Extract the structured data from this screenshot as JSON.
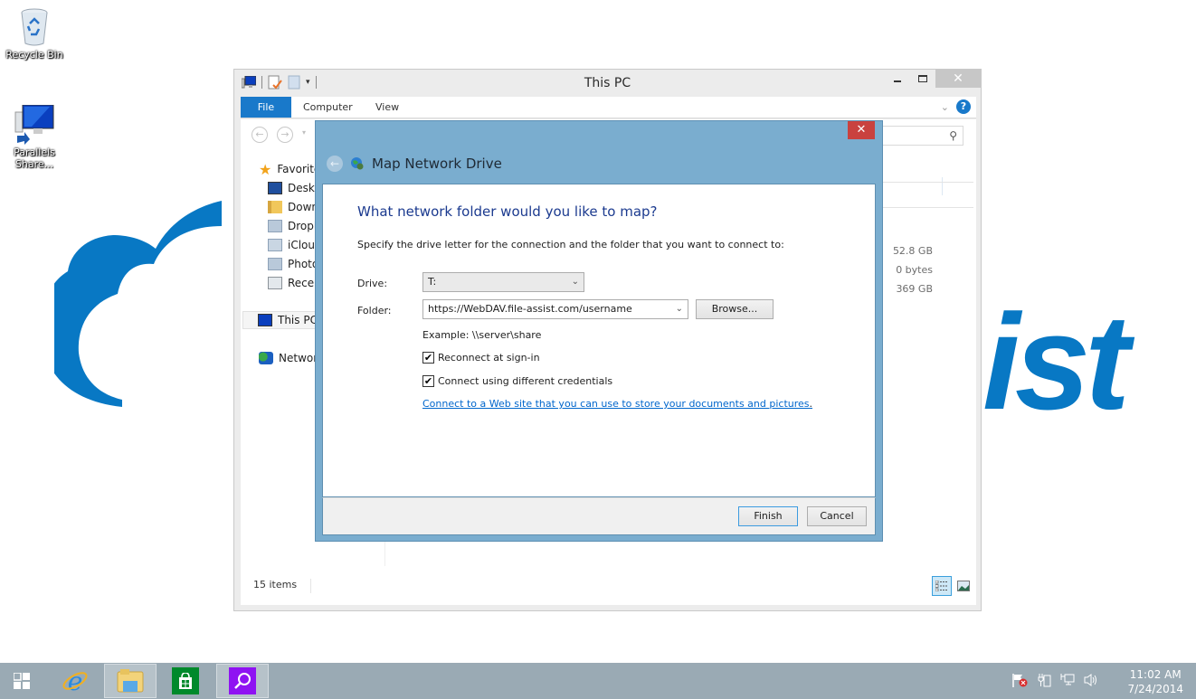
{
  "desktop": {
    "icons": [
      {
        "label": "Recycle Bin",
        "icon": "recycle-bin-icon"
      },
      {
        "label": "Parallels Share...",
        "icon": "parallels-share-icon"
      }
    ],
    "background_logo": {
      "text_fragment": "ist",
      "color": "#0878c4"
    }
  },
  "explorer": {
    "title": "This PC",
    "quick_access": [
      "computer-icon",
      "properties-icon",
      "new-folder-icon",
      "customize-dropdown-icon"
    ],
    "ribbon_tabs": [
      {
        "label": "File",
        "active": true
      },
      {
        "label": "Computer"
      },
      {
        "label": "View"
      }
    ],
    "nav": {
      "favorites_label": "Favorites",
      "favorites": [
        "Desktop",
        "Downloads",
        "Dropbox",
        "iCloud Photos",
        "Photo Stream",
        "Recent places"
      ],
      "favorites_visible": [
        "Deskto",
        "Down",
        "Dropb",
        "iClouc",
        "Photo",
        "Recen"
      ],
      "this_pc": "This PC",
      "network": "Network"
    },
    "sizes": [
      "52.8 GB",
      "0 bytes",
      "369 GB"
    ],
    "status": "15 items",
    "accent": "#1979ca"
  },
  "dialog": {
    "title": "Map Network Drive",
    "heading": "What network folder would you like to map?",
    "description": "Specify the drive letter for the connection and the folder that you want to connect to:",
    "drive_label": "Drive:",
    "drive_value": "T:",
    "folder_label": "Folder:",
    "folder_value": "https://WebDAV.file-assist.com/username",
    "browse_label": "Browse...",
    "example": "Example: \\\\server\\share",
    "reconnect_label": "Reconnect at sign-in",
    "reconnect_checked": true,
    "credentials_label": "Connect using different credentials",
    "credentials_checked": true,
    "link_text": "Connect to a Web site that you can use to store your documents and pictures",
    "link_suffix": ".",
    "finish_label": "Finish",
    "cancel_label": "Cancel",
    "close_color": "#c9423f"
  },
  "taskbar": {
    "items": [
      "start",
      "internet-explorer",
      "file-explorer",
      "store",
      "search"
    ],
    "time": "11:02 AM",
    "date": "7/24/2014"
  }
}
